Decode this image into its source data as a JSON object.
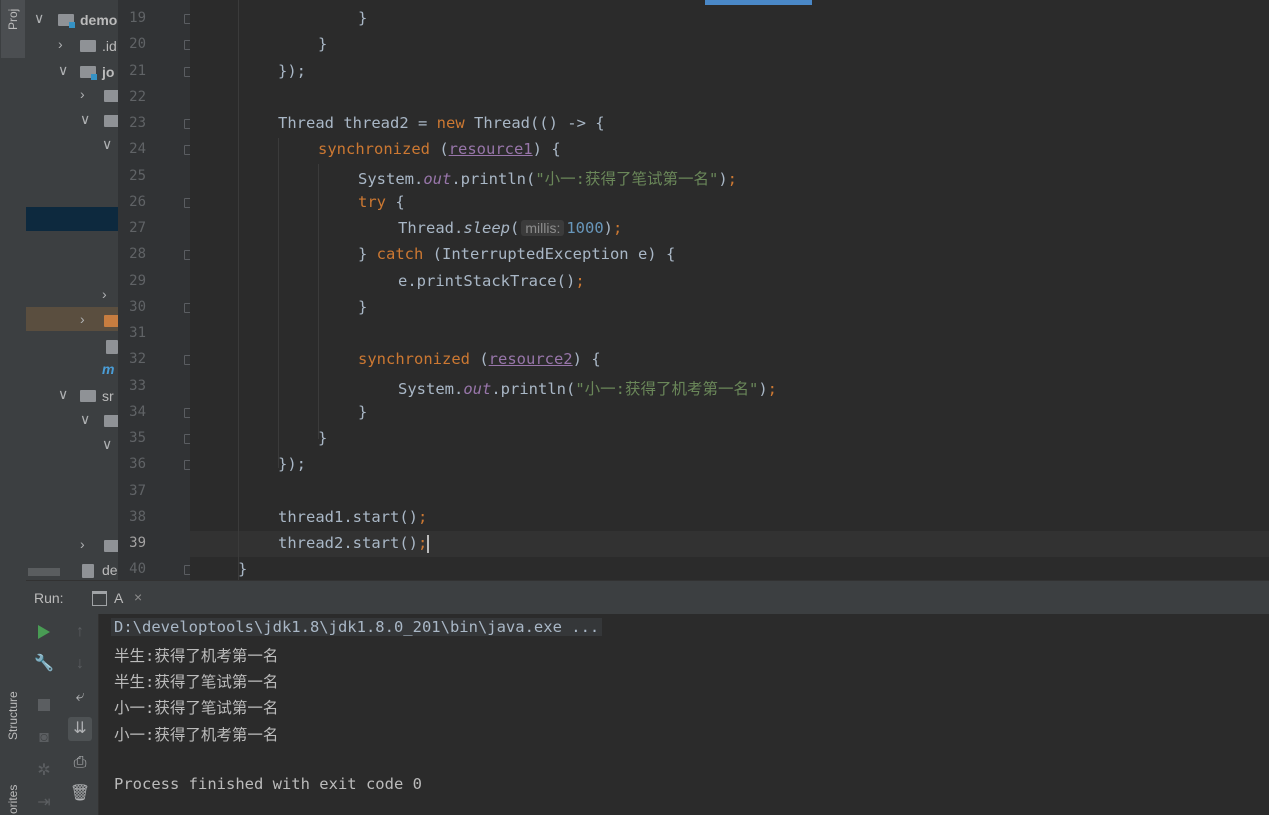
{
  "side_tabs": {
    "project": "Proj",
    "structure": "Structure",
    "favorites": "orites"
  },
  "project_tree": {
    "items": [
      {
        "label": "demo",
        "chev": "∨"
      },
      {
        "label": ".id",
        "chev": "›"
      },
      {
        "label": "jo",
        "chev": "∨"
      },
      {
        "label": "",
        "chev": "›"
      },
      {
        "label": "",
        "chev": "∨"
      },
      {
        "label": "",
        "chev": "∨"
      },
      {
        "label": "m",
        "chev": ""
      },
      {
        "label": "sr",
        "chev": "∨"
      },
      {
        "label": "",
        "chev": "∨"
      },
      {
        "label": "",
        "chev": "∨"
      },
      {
        "label": "",
        "chev": "›"
      },
      {
        "label": "de",
        "chev": ""
      }
    ]
  },
  "editor": {
    "line_numbers": [
      "19",
      "20",
      "21",
      "22",
      "23",
      "24",
      "25",
      "26",
      "27",
      "28",
      "29",
      "30",
      "31",
      "32",
      "33",
      "34",
      "35",
      "36",
      "37",
      "38",
      "39",
      "40"
    ],
    "current_line": "39",
    "param_hint": "millis:",
    "code": {
      "l19": "}",
      "l20": "}",
      "l21": "});",
      "l23_type": "Thread",
      "l23_var": " thread2 = ",
      "l23_new": "new",
      "l23_rest": " Thread(() -> {",
      "l24_kw": "synchronized",
      "l24_open": " (",
      "l24_field": "resource1",
      "l24_close": ") {",
      "l25_a": "System.",
      "l25_out": "out",
      "l25_b": ".println(",
      "l25_str": "\"小一:获得了笔试第一名\"",
      "l25_c": ")",
      "l25_semi": ";",
      "l26_kw": "try",
      "l26_rest": " {",
      "l27_a": "Thread.",
      "l27_sleep": "sleep",
      "l27_b": "(",
      "l27_num": "1000",
      "l27_c": ")",
      "l27_semi": ";",
      "l28_a": "} ",
      "l28_kw": "catch",
      "l28_rest": " (InterruptedException e) {",
      "l29_a": "e.printStackTrace()",
      "l29_semi": ";",
      "l30": "}",
      "l32_kw": "synchronized",
      "l32_open": " (",
      "l32_field": "resource2",
      "l32_close": ") {",
      "l33_a": "System.",
      "l33_out": "out",
      "l33_b": ".println(",
      "l33_str": "\"小一:获得了机考第一名\"",
      "l33_c": ")",
      "l33_semi": ";",
      "l34": "}",
      "l35": "}",
      "l36": "});",
      "l38_a": "thread1.start()",
      "l38_semi": ";",
      "l39_a": "thread2.start()",
      "l39_semi": ";",
      "l40": "}"
    }
  },
  "run_panel": {
    "label": "Run:",
    "tab_label": "A",
    "tab_close": "×",
    "console": [
      "D:\\developtools\\jdk1.8\\jdk1.8.0_201\\bin\\java.exe ...",
      "半生:获得了机考第一名",
      "半生:获得了笔试第一名",
      "小一:获得了笔试第一名",
      "小一:获得了机考第一名",
      "",
      "Process finished with exit code 0"
    ]
  },
  "icons": {
    "run": "play-icon",
    "wrench": "wrench-icon",
    "stop": "stop-icon",
    "camera": "camera-icon",
    "up": "arrow-up-icon",
    "down": "arrow-down-icon",
    "wrap": "soft-wrap-icon",
    "scroll_end": "scroll-to-end-icon",
    "print": "print-icon",
    "trash": "trash-icon"
  },
  "colors": {
    "keyword": "#cc7832",
    "string": "#6a8759",
    "number": "#6897bb",
    "field": "#9876aa",
    "run_green": "#499c54"
  }
}
